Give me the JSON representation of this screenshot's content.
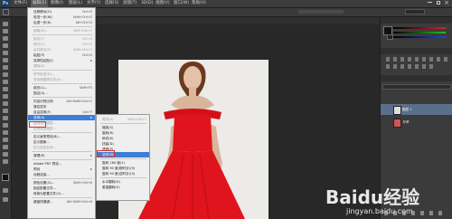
{
  "menubar": {
    "logo": "Ps",
    "items": [
      "文件(F)",
      "编辑(E)",
      "图像(I)",
      "图层(L)",
      "文字(Y)",
      "选择(S)",
      "滤镜(T)",
      "3D(D)",
      "视图(V)",
      "窗口(W)",
      "帮助(H)"
    ],
    "active_index": 1
  },
  "edit_menu": {
    "items": [
      {
        "label": "还原移动(O)",
        "shortcut": "Ctrl+Z",
        "dim": false
      },
      {
        "label": "前进一步(W)",
        "shortcut": "Shift+Ctrl+Z",
        "dim": false
      },
      {
        "label": "后退一步(K)",
        "shortcut": "Alt+Ctrl+Z",
        "dim": false
      },
      {
        "label": "渐隐(D)...",
        "shortcut": "Shift+Ctrl+F",
        "dim": true
      },
      {
        "label": "剪切(T)",
        "shortcut": "Ctrl+X",
        "dim": true
      },
      {
        "label": "拷贝(C)",
        "shortcut": "Ctrl+C",
        "dim": true
      },
      {
        "label": "合并拷贝(Y)",
        "shortcut": "Shift+Ctrl+C",
        "dim": true
      },
      {
        "label": "粘贴(P)",
        "shortcut": "Ctrl+V",
        "dim": false
      },
      {
        "label": "选择性粘贴(I)",
        "shortcut": "",
        "dim": false,
        "submenu": true
      },
      {
        "label": "清除(E)",
        "shortcut": "",
        "dim": true
      },
      {
        "label": "拼写检查(H)...",
        "shortcut": "",
        "dim": true
      },
      {
        "label": "查找和替换文本(X)...",
        "shortcut": "",
        "dim": true
      },
      {
        "label": "填充(L)...",
        "shortcut": "Shift+F5",
        "dim": false
      },
      {
        "label": "描边(S)...",
        "shortcut": "",
        "dim": false
      },
      {
        "label": "内容识别比例",
        "shortcut": "Alt+Shift+Ctrl+C",
        "dim": false
      },
      {
        "label": "操控变形",
        "shortcut": "",
        "dim": false
      },
      {
        "label": "自由变换(F)",
        "shortcut": "Ctrl+T",
        "dim": false
      },
      {
        "label": "变换(A)",
        "shortcut": "",
        "dim": false,
        "submenu": true,
        "highlight": true
      },
      {
        "label": "自动对齐图层...",
        "shortcut": "",
        "dim": true
      },
      {
        "label": "自动混合图层...",
        "shortcut": "",
        "dim": true
      },
      {
        "label": "定义画笔预设(B)...",
        "shortcut": "",
        "dim": false
      },
      {
        "label": "定义图案...",
        "shortcut": "",
        "dim": false
      },
      {
        "label": "定义自定形状...",
        "shortcut": "",
        "dim": true
      },
      {
        "label": "清理(R)",
        "shortcut": "",
        "dim": false,
        "submenu": true
      },
      {
        "label": "Adobe PDF 预设...",
        "shortcut": "",
        "dim": false
      },
      {
        "label": "预设",
        "shortcut": "",
        "dim": false,
        "submenu": true
      },
      {
        "label": "远程连接...",
        "shortcut": "",
        "dim": false
      },
      {
        "label": "颜色设置(G)...",
        "shortcut": "Shift+Ctrl+K",
        "dim": false
      },
      {
        "label": "指定配置文件...",
        "shortcut": "",
        "dim": false
      },
      {
        "label": "转换为配置文件(V)...",
        "shortcut": "",
        "dim": false
      },
      {
        "label": "键盘快捷键...",
        "shortcut": "Alt+Shift+Ctrl+K",
        "dim": false
      }
    ]
  },
  "transform_menu": {
    "items": [
      {
        "label": "再次(A)",
        "shortcut": "Shift+Ctrl+T",
        "dim": true
      },
      {
        "label": "缩放(S)",
        "shortcut": ""
      },
      {
        "label": "旋转(R)",
        "shortcut": ""
      },
      {
        "label": "斜切(K)",
        "shortcut": ""
      },
      {
        "label": "扭曲(D)",
        "shortcut": ""
      },
      {
        "label": "透视(P)",
        "shortcut": ""
      },
      {
        "label": "变形(W)",
        "shortcut": "",
        "highlight": true
      },
      {
        "label": "旋转 180 度(1)",
        "shortcut": ""
      },
      {
        "label": "旋转 90 度(顺时针)(9)",
        "shortcut": ""
      },
      {
        "label": "旋转 90 度(逆时针)(0)",
        "shortcut": ""
      },
      {
        "label": "水平翻转(H)",
        "shortcut": ""
      },
      {
        "label": "垂直翻转(V)",
        "shortcut": ""
      }
    ]
  },
  "panels": {
    "layers": [
      {
        "name": "图层 1"
      },
      {
        "name": "背景"
      }
    ]
  },
  "watermark": {
    "brand": "Baidu经验",
    "url": "jingyan.baidu.com"
  },
  "colors": {
    "highlight": "#3d7fd6",
    "callout": "#e02a2a",
    "dress": "#e0141c"
  }
}
